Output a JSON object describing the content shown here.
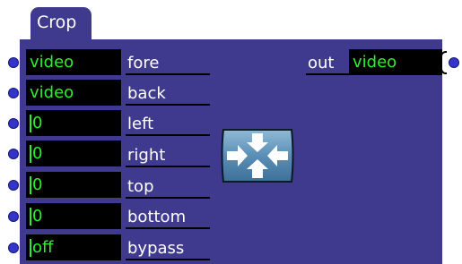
{
  "actor": {
    "title": "Crop",
    "icon": "crop-arrows-icon"
  },
  "inputs": [
    {
      "label": "fore",
      "value": "video"
    },
    {
      "label": "back",
      "value": "video"
    },
    {
      "label": "left",
      "value": "0"
    },
    {
      "label": "right",
      "value": "0"
    },
    {
      "label": "top",
      "value": "0"
    },
    {
      "label": "bottom",
      "value": "0"
    },
    {
      "label": "bypass",
      "value": "off"
    }
  ],
  "outputs": [
    {
      "label": "out",
      "value": "video"
    }
  ],
  "colors": {
    "body": "#3f3a8e",
    "field_bg": "#000000",
    "field_text": "#2df02d",
    "port": "#3434c8",
    "icon_bg": "#5b8fb6"
  }
}
